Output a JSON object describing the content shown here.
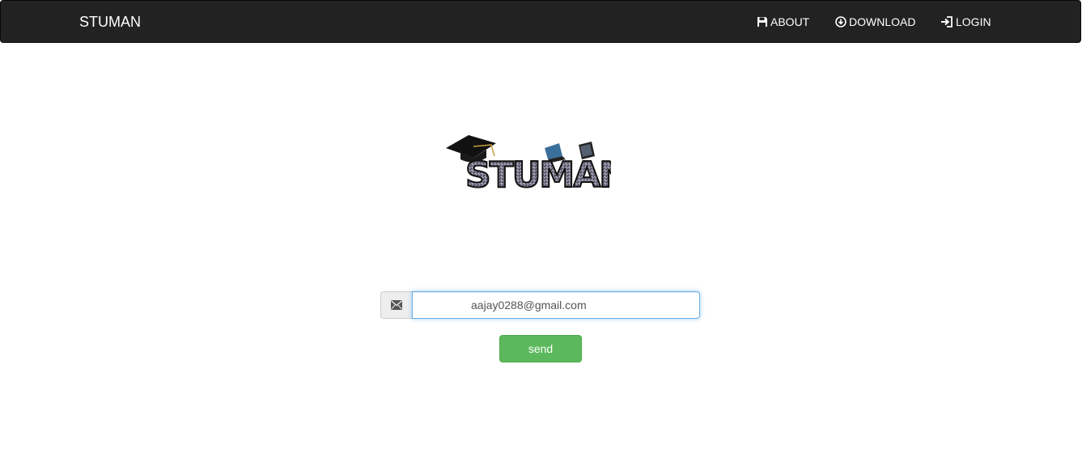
{
  "navbar": {
    "brand": "STUMAN",
    "items": [
      {
        "label": "ABOUT",
        "icon": "floppy-disk-icon"
      },
      {
        "label": "DOWNLOAD",
        "icon": "download-circle-icon"
      },
      {
        "label": "LOGIN",
        "icon": "login-icon"
      }
    ]
  },
  "logo": {
    "text": "STUMAN"
  },
  "form": {
    "email_icon": "envelope-icon",
    "email_value": "aajay0288@gmail.com",
    "send_label": "send"
  },
  "colors": {
    "navbar_bg": "#222222",
    "send_button": "#5cb85c",
    "input_focus": "#66afe9"
  }
}
